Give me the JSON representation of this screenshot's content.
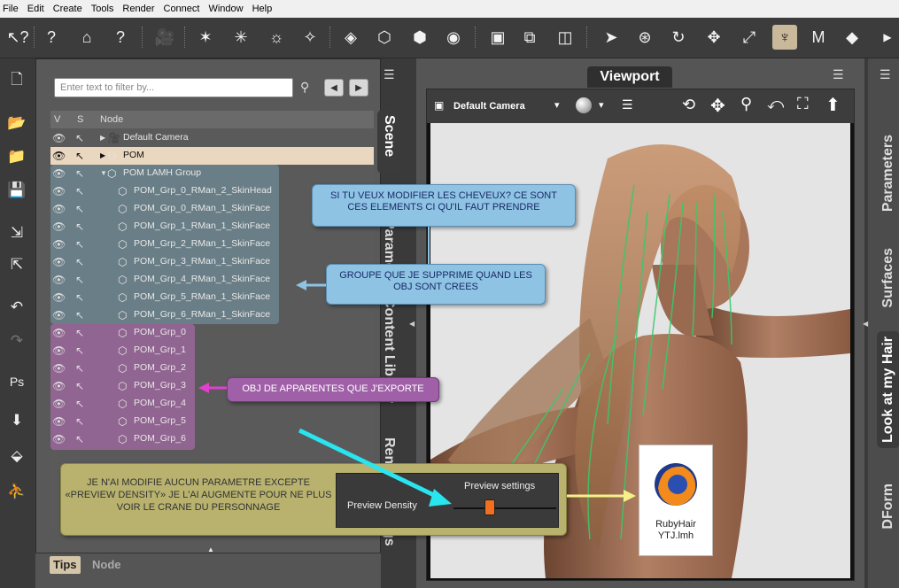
{
  "menu": [
    "File",
    "Edit",
    "Create",
    "Tools",
    "Render",
    "Connect",
    "Window",
    "Help"
  ],
  "scene": {
    "filter_placeholder": "Enter text to filter by...",
    "columns": {
      "v": "V",
      "s": "S",
      "node": "Node"
    },
    "tab_label": "Scene",
    "rows": [
      {
        "label": "Default Camera",
        "indent": 0,
        "expander": "▶"
      },
      {
        "label": "POM",
        "indent": 0,
        "expander": "▶"
      },
      {
        "label": "POM LAMH Group",
        "indent": 0,
        "expander": "▼"
      },
      {
        "label": "POM_Grp_0_RMan_2_SkinHead",
        "indent": 1
      },
      {
        "label": "POM_Grp_0_RMan_1_SkinFace",
        "indent": 1
      },
      {
        "label": "POM_Grp_1_RMan_1_SkinFace",
        "indent": 1
      },
      {
        "label": "POM_Grp_2_RMan_1_SkinFace",
        "indent": 1
      },
      {
        "label": "POM_Grp_3_RMan_1_SkinFace",
        "indent": 1
      },
      {
        "label": "POM_Grp_4_RMan_1_SkinFace",
        "indent": 1
      },
      {
        "label": "POM_Grp_5_RMan_1_SkinFace",
        "indent": 1
      },
      {
        "label": "POM_Grp_6_RMan_1_SkinFace",
        "indent": 1
      },
      {
        "label": "POM_Grp_0",
        "indent": 1
      },
      {
        "label": "POM_Grp_1",
        "indent": 1
      },
      {
        "label": "POM_Grp_2",
        "indent": 1
      },
      {
        "label": "POM_Grp_3",
        "indent": 1
      },
      {
        "label": "POM_Grp_4",
        "indent": 1
      },
      {
        "label": "POM_Grp_5",
        "indent": 1
      },
      {
        "label": "POM_Grp_6",
        "indent": 1
      }
    ]
  },
  "side_tabs_left": [
    "Scene",
    "Parameters",
    "Content Library",
    "Render Settings"
  ],
  "bottom_tabs": {
    "tips": "Tips",
    "node": "Node"
  },
  "viewport": {
    "tab": "Viewport",
    "camera": "Default Camera"
  },
  "right_tabs": [
    "Parameters",
    "Surfaces",
    "Look at my Hair",
    "DForm"
  ],
  "notes": {
    "n1": "SI TU VEUX MODIFIER LES CHEVEUX? CE SONT CES ELEMENTS CI QU'IL FAUT PRENDRE",
    "n2": "GROUPE QUE JE SUPPRIME QUAND LES OBJ SONT CREES",
    "n3": "OBJ DE APPARENTES QUE J'EXPORTE",
    "n4": "JE N'AI MODIFIE AUCUN PARAMETRE EXCEPTE «PREVIEW DENSITY» JE L'AI AUGMENTE POUR NE PLUS VOIR LE CRANE DU PERSONNAGE"
  },
  "preview": {
    "title": "Preview settings",
    "label": "Preview Density",
    "level": 0.35
  },
  "file_card": {
    "name": "RubyHair YTJ.lmh"
  },
  "colors": {
    "highlight_blue": "#6f8b96",
    "highlight_pink": "#a86aa8",
    "note_blue": "#8ec3e4",
    "note_pink": "#a060a8",
    "note_olive": "#b8b26e",
    "arrow_cyan": "#29e5f0",
    "arrow_yellow": "#f5f08a",
    "arrow_pink": "#e040d0"
  }
}
